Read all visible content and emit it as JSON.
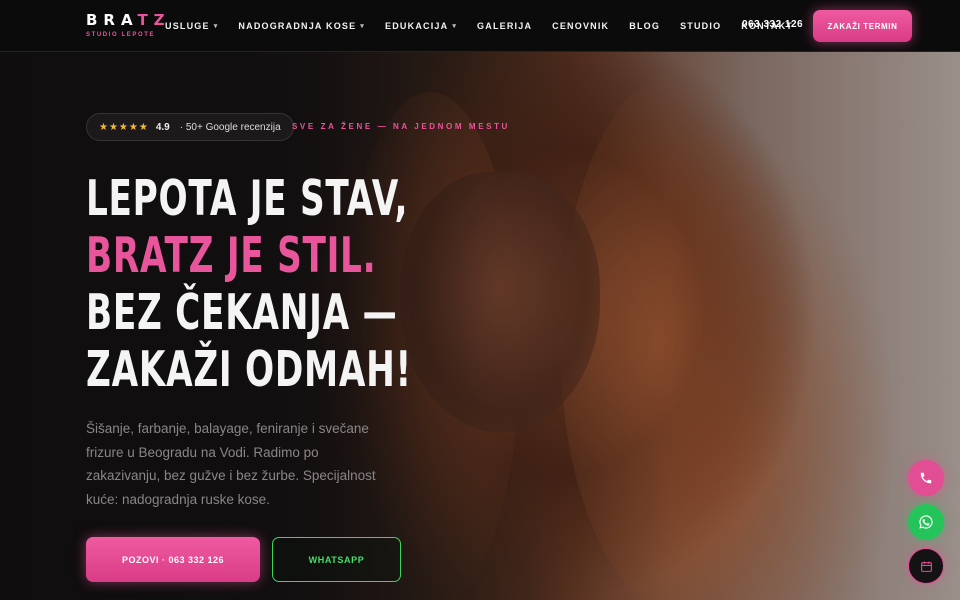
{
  "brand": {
    "logo_prefix": "BRA",
    "logo_suffix": "TZ",
    "logo_sub": "STUDIO LEPOTE"
  },
  "nav": {
    "items": [
      {
        "label": "USLUGE",
        "dropdown": true
      },
      {
        "label": "NADOGRADNJA KOSE",
        "dropdown": true
      },
      {
        "label": "EDUKACIJA",
        "dropdown": true
      },
      {
        "label": "GALERIJA",
        "dropdown": false
      },
      {
        "label": "CENOVNIK",
        "dropdown": false
      },
      {
        "label": "BLOG",
        "dropdown": false
      },
      {
        "label": "STUDIO",
        "dropdown": false
      },
      {
        "label": "KONTAKT",
        "dropdown": false
      }
    ],
    "caret": "▾",
    "phone": "063 332 126",
    "cta_label": "ZAKAŽI TERMIN"
  },
  "hero": {
    "badge": {
      "stars": "★★★★★",
      "rating": "4.9",
      "reviews": "· 50+ Google recenzija"
    },
    "tagline": "SVE ZA ŽENE — NA JEDNOM MESTU",
    "headline": {
      "line1": "LEPOTA JE STAV,",
      "line2": "BRATZ JE STIL.",
      "line3": "BEZ ČEKANJA —",
      "line4": "ZAKAŽI ODMAH!"
    },
    "description": "Šišanje, farbanje, balayage, feniranje i svečane frizure u Beogradu na Vodi. Radimo po zakazivanju, bez gužve i bez žurbe. Specijalnost kuće: nadogradnja ruske kose.",
    "call_button": "POZOVI · 063 332 126",
    "whatsapp_button": "WHATSAPP"
  },
  "floating": {
    "icons": [
      "phone-icon",
      "whatsapp-icon",
      "calendar-icon"
    ]
  },
  "colors": {
    "accent": "#e8559a",
    "whatsapp": "#36d65f",
    "star": "#f5b82e"
  }
}
